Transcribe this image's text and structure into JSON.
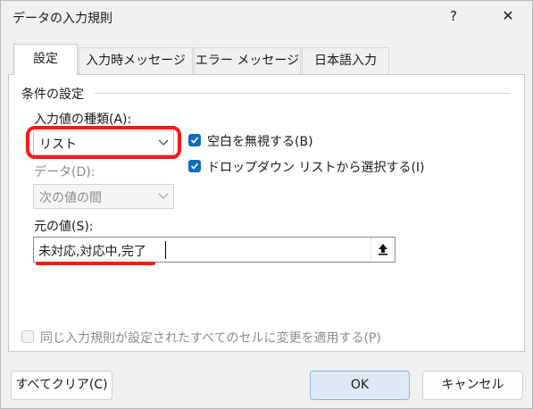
{
  "window": {
    "title": "データの入力規則",
    "help_label": "?",
    "close_label": "✕"
  },
  "tabs": [
    {
      "label": "設定",
      "active": true
    },
    {
      "label": "入力時メッセージ",
      "active": false
    },
    {
      "label": "エラー メッセージ",
      "active": false
    },
    {
      "label": "日本語入力",
      "active": false
    }
  ],
  "settings": {
    "group_label": "条件の設定",
    "allow_label": "入力値の種類(A):",
    "allow_value": "リスト",
    "ignore_blank_label": "空白を無視する(B)",
    "ignore_blank_checked": true,
    "dropdown_label": "ドロップダウン リストから選択する(I)",
    "dropdown_checked": true,
    "data_label": "データ(D):",
    "data_value": "次の値の間",
    "source_label": "元の値(S):",
    "source_value": "未対応,対応中,完了",
    "apply_all_label": "同じ入力規則が設定されたすべてのセルに変更を適用する(P)",
    "apply_all_checked": false
  },
  "buttons": {
    "clear_all": "すべてクリア(C)",
    "ok": "OK",
    "cancel": "キャンセル"
  },
  "colors": {
    "accent": "#0f6cbd",
    "highlight": "#ff1515"
  }
}
